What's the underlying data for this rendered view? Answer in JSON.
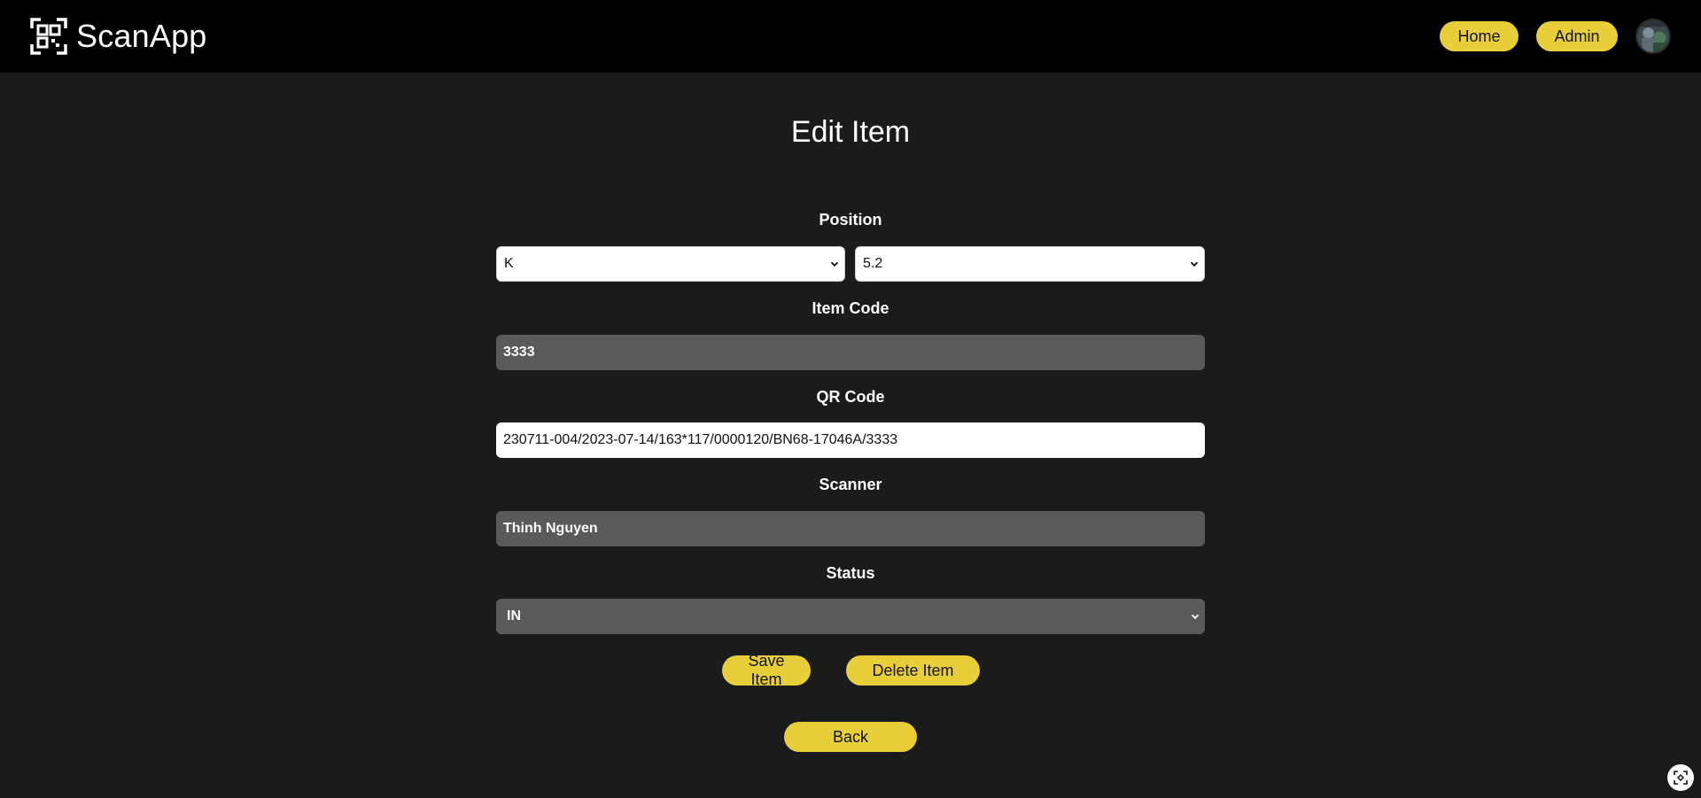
{
  "app": {
    "name": "ScanApp"
  },
  "nav": {
    "home_label": "Home",
    "admin_label": "Admin"
  },
  "page": {
    "title": "Edit Item"
  },
  "form": {
    "position_label": "Position",
    "position_row": "K",
    "position_slot": "5.2",
    "item_code_label": "Item Code",
    "item_code_value": "3333",
    "qr_code_label": "QR Code",
    "qr_code_value": "230711-004/2023-07-14/163*117/0000120/BN68-17046A/3333",
    "scanner_label": "Scanner",
    "scanner_value": "Thinh Nguyen",
    "status_label": "Status",
    "status_value": "IN"
  },
  "actions": {
    "save_label": "Save Item",
    "delete_label": "Delete Item",
    "back_label": "Back"
  },
  "colors": {
    "accent": "#e8cf3a",
    "background": "#1b1b1b",
    "topbar": "#000000",
    "field_disabled": "#5a5a5a"
  }
}
